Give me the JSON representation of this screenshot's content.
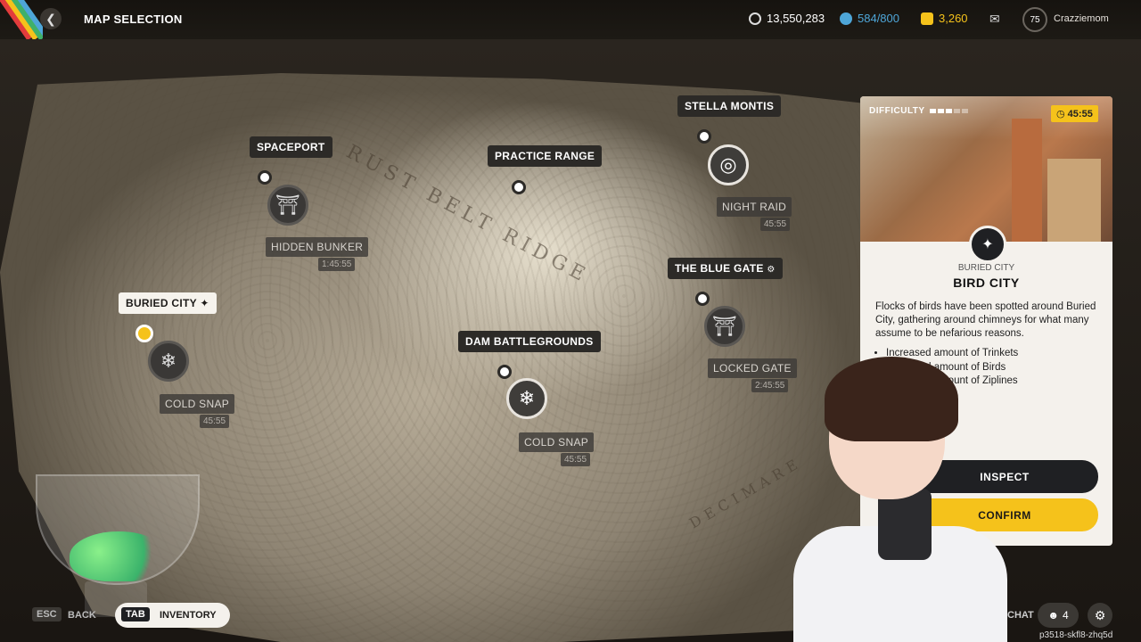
{
  "header": {
    "title": "MAP SELECTION",
    "credits": "13,550,283",
    "stash": "584/800",
    "tokens": "3,260",
    "level": "75",
    "username": "Crazziemom"
  },
  "colors": {
    "accent": "#f5c21b",
    "dark": "#1f2023",
    "stash": "#4ea6d8"
  },
  "map": {
    "region_labels": [
      "RUST BELT RIDGE",
      "DECIMARE"
    ],
    "locations": [
      {
        "name": "SPACEPORT",
        "modifier": "HIDDEN BUNKER",
        "time": "1:45:55",
        "icon": "bunker-icon"
      },
      {
        "name": "PRACTICE RANGE"
      },
      {
        "name": "STELLA MONTIS",
        "modifier": "NIGHT RAID",
        "time": "45:55",
        "icon": "night-raid-icon"
      },
      {
        "name": "THE BLUE GATE",
        "modifier": "LOCKED GATE",
        "time": "2:45:55",
        "icon": "locked-gate-icon"
      },
      {
        "name": "BURIED CITY",
        "modifier": "COLD SNAP",
        "time": "45:55",
        "icon": "snowflake-icon",
        "selected": true
      },
      {
        "name": "DAM BATTLEGROUNDS",
        "modifier": "COLD SNAP",
        "time": "45:55",
        "icon": "snowflake-icon"
      }
    ]
  },
  "card": {
    "difficulty_label": "DIFFICULTY",
    "timer": "45:55",
    "subtitle": "BURIED CITY",
    "title": "BIRD CITY",
    "description": "Flocks of birds have been spotted around Buried City, gathering around chimneys for what many assume to be nefarious reasons.",
    "bullets": [
      "Increased amount of Trinkets",
      "Increased amount of Birds",
      "Increased amount of Ziplines"
    ],
    "inspect": "INSPECT",
    "confirm": "CONFIRM"
  },
  "footer": {
    "esc_key": "ESC",
    "back": "BACK",
    "tab_key": "TAB",
    "inventory": "INVENTORY",
    "chat": "CHAT",
    "friends_count": "4",
    "session_id": "p3518-skfl8-zhq5d"
  }
}
